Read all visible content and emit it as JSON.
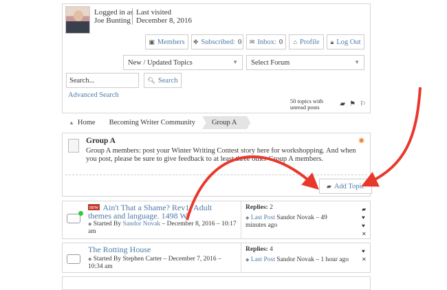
{
  "user": {
    "logged_in_label": "Logged in as",
    "name": "Joe Bunting",
    "visited_label": "Last visited",
    "visited_date": "December 8, 2016"
  },
  "buttons": {
    "members": "Members",
    "subscribed": "Subscribed:",
    "subscribed_count": "0",
    "inbox": "Inbox:",
    "inbox_count": "0",
    "profile": "Profile",
    "logout": "Log Out",
    "search": "Search",
    "add_topic": "Add Topic"
  },
  "selects": {
    "topics": "New / Updated Topics",
    "forum": "Select Forum"
  },
  "search": {
    "value": "Search...",
    "advanced": "Advanced Search"
  },
  "topics_summary": {
    "line1": "50 topics with",
    "line2": "unread posts"
  },
  "breadcrumb": [
    "Home",
    "Becoming Writer Community",
    "Group A"
  ],
  "group": {
    "title": "Group A",
    "description": "Group A members: post your Winter Writing Contest story here for workshopping. And when you post, please be sure to give feedback to at least three other Group A members."
  },
  "topics": [
    {
      "badge": "new",
      "title": "Ain't That a Shame? Rev1: Adult themes and language. 1498 W",
      "started_by": "Started By",
      "author": "Sandor Novak",
      "date": "December 8, 2016",
      "time": "10:17 am",
      "replies_label": "Replies:",
      "replies": "2",
      "last_post_label": "Last Post",
      "last_author": "Sandor Novak",
      "last_ago": "49 minutes ago"
    },
    {
      "title": "The Rotting House",
      "started_by": "Started By",
      "author": "Stephen Carter",
      "date": "December 7, 2016",
      "time": "10:34 am",
      "replies_label": "Replies:",
      "replies": "4",
      "last_post_label": "Last Post",
      "last_author": "Sandor Novak",
      "last_ago": "1 hour ago"
    }
  ],
  "colors": {
    "link": "#4e79a7",
    "annotation_arrow": "#e8382c",
    "new_badge": "#c0392b"
  }
}
